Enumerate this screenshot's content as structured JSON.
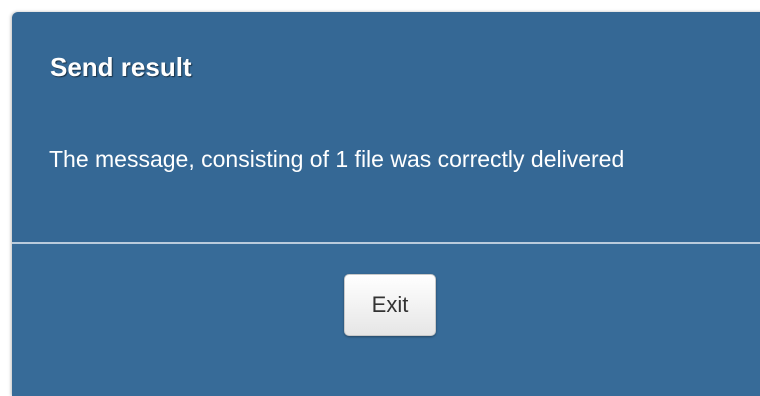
{
  "dialog": {
    "title": "Send result",
    "message": "The message, consisting of 1 file was correctly delivered",
    "exit_label": "Exit"
  },
  "colors": {
    "dialog_background": "#356895",
    "divider": "#b9cbdc",
    "button_background": "#f2f2f2",
    "button_text": "#333333"
  }
}
